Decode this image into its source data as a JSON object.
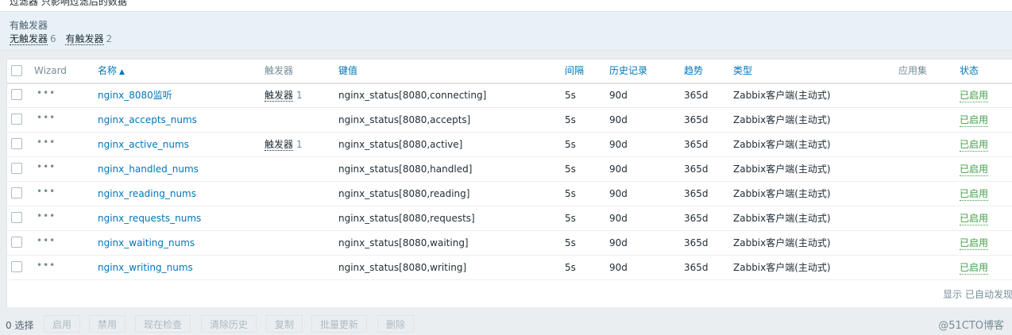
{
  "filter": {
    "cut_text": "过滤器 只影响过滤后的数据",
    "title": "有触发器",
    "options": [
      {
        "label": "无触发器",
        "count": "6"
      },
      {
        "label": "有触发器",
        "count": "2"
      }
    ]
  },
  "table": {
    "headers": {
      "wizard": "Wizard",
      "name": "名称",
      "triggers": "触发器",
      "key": "键值",
      "interval": "间隔",
      "history": "历史记录",
      "trends": "趋势",
      "type": "类型",
      "apps": "应用集",
      "status": "状态"
    },
    "sort_arrow": "▲",
    "rows": [
      {
        "name": "nginx_8080监听",
        "trigger": "触发器",
        "trigger_count": "1",
        "key": "nginx_status[8080,connecting]",
        "interval": "5s",
        "history": "90d",
        "trends": "365d",
        "type": "Zabbix客户端(主动式)",
        "status": "已启用"
      },
      {
        "name": "nginx_accepts_nums",
        "trigger": "",
        "trigger_count": "",
        "key": "nginx_status[8080,accepts]",
        "interval": "5s",
        "history": "90d",
        "trends": "365d",
        "type": "Zabbix客户端(主动式)",
        "status": "已启用"
      },
      {
        "name": "nginx_active_nums",
        "trigger": "触发器",
        "trigger_count": "1",
        "key": "nginx_status[8080,active]",
        "interval": "5s",
        "history": "90d",
        "trends": "365d",
        "type": "Zabbix客户端(主动式)",
        "status": "已启用"
      },
      {
        "name": "nginx_handled_nums",
        "trigger": "",
        "trigger_count": "",
        "key": "nginx_status[8080,handled]",
        "interval": "5s",
        "history": "90d",
        "trends": "365d",
        "type": "Zabbix客户端(主动式)",
        "status": "已启用"
      },
      {
        "name": "nginx_reading_nums",
        "trigger": "",
        "trigger_count": "",
        "key": "nginx_status[8080,reading]",
        "interval": "5s",
        "history": "90d",
        "trends": "365d",
        "type": "Zabbix客户端(主动式)",
        "status": "已启用"
      },
      {
        "name": "nginx_requests_nums",
        "trigger": "",
        "trigger_count": "",
        "key": "nginx_status[8080,requests]",
        "interval": "5s",
        "history": "90d",
        "trends": "365d",
        "type": "Zabbix客户端(主动式)",
        "status": "已启用"
      },
      {
        "name": "nginx_waiting_nums",
        "trigger": "",
        "trigger_count": "",
        "key": "nginx_status[8080,waiting]",
        "interval": "5s",
        "history": "90d",
        "trends": "365d",
        "type": "Zabbix客户端(主动式)",
        "status": "已启用"
      },
      {
        "name": "nginx_writing_nums",
        "trigger": "",
        "trigger_count": "",
        "key": "nginx_status[8080,writing]",
        "interval": "5s",
        "history": "90d",
        "trends": "365d",
        "type": "Zabbix客户端(主动式)",
        "status": "已启用"
      }
    ],
    "displaying": "显示 已自动发现"
  },
  "footer": {
    "selected": "0 选择",
    "buttons": [
      "启用",
      "禁用",
      "现在检查",
      "清除历史",
      "复制",
      "批量更新",
      "删除"
    ],
    "watermark": "@51CTO博客"
  },
  "colors": {
    "link": "#0275b8",
    "enabled": "#429e47",
    "filter_bg": "#e9f1f8",
    "page_bg": "#ebeef0"
  }
}
